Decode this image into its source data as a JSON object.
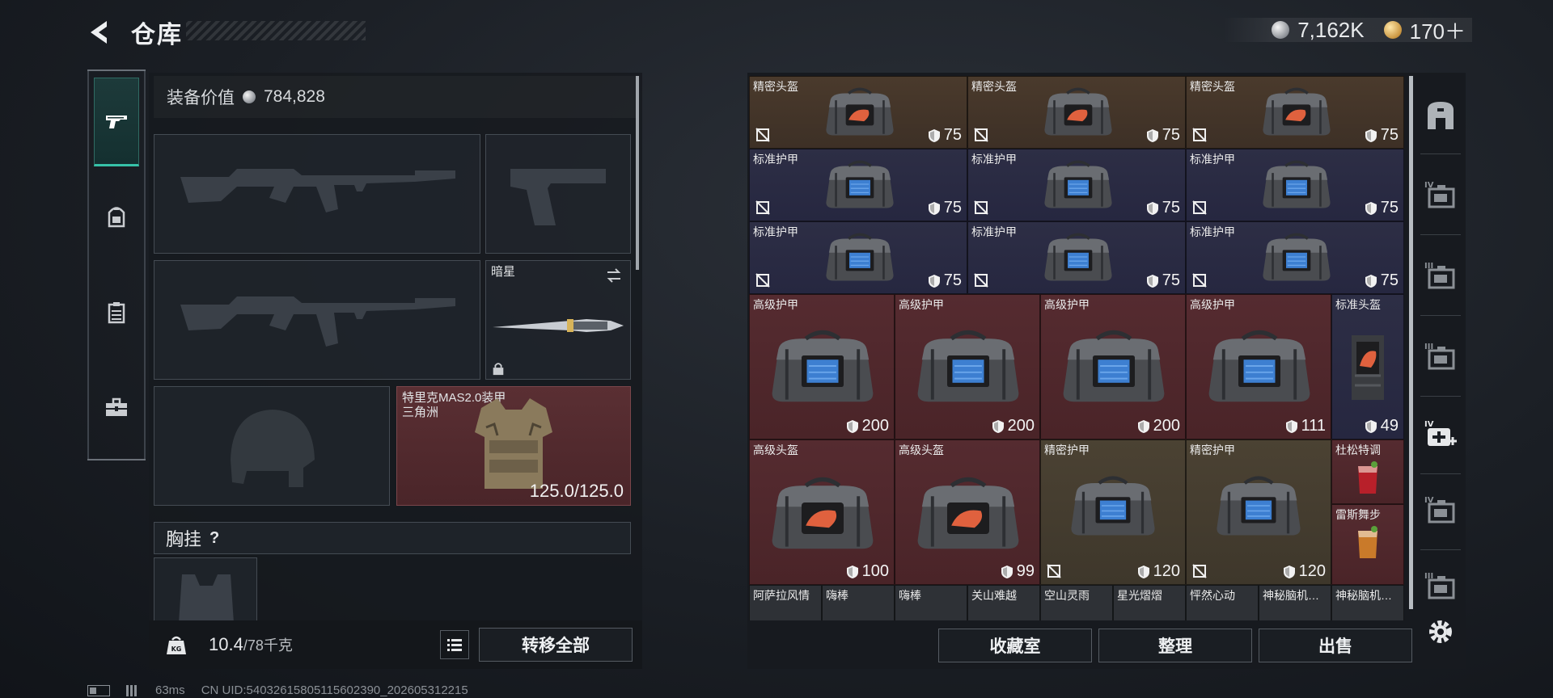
{
  "header": {
    "title": "仓库",
    "currencies": [
      {
        "icon": "silver-coin-icon",
        "value": "7,162K"
      },
      {
        "icon": "gold-coin-icon",
        "value": "170＋"
      }
    ]
  },
  "left_sidebar": {
    "items": [
      {
        "icon": "pistol-icon",
        "active": true
      },
      {
        "icon": "backpack-icon",
        "active": false
      },
      {
        "icon": "clipboard-icon",
        "active": false
      },
      {
        "icon": "toolbox-icon",
        "active": false
      }
    ]
  },
  "equipment": {
    "value_label": "装备价值",
    "value": "784,828",
    "melee_slot": {
      "label": "暗星"
    },
    "armor_slot": {
      "name": "特里克MAS2.0装甲",
      "subtitle": "三角洲",
      "durability": "125.0/125.0"
    },
    "chest_rig_label": "胸挂",
    "chest_rig_help": "?",
    "weight": "10.4",
    "weight_max": "/78千克",
    "weight_icon_text": "KG",
    "transfer_all": "转移全部"
  },
  "stash": {
    "rows": [
      [
        {
          "name": "精密头盔",
          "dur": "75",
          "bg": "brown",
          "kind": "helmet"
        },
        {
          "name": "精密头盔",
          "dur": "75",
          "bg": "brown",
          "kind": "helmet"
        },
        {
          "name": "精密头盔",
          "dur": "75",
          "bg": "brown",
          "kind": "helmet"
        }
      ],
      [
        {
          "name": "标准护甲",
          "dur": "75",
          "bg": "navy",
          "kind": "armor"
        },
        {
          "name": "标准护甲",
          "dur": "75",
          "bg": "navy",
          "kind": "armor"
        },
        {
          "name": "标准护甲",
          "dur": "75",
          "bg": "navy",
          "kind": "armor"
        }
      ],
      [
        {
          "name": "标准护甲",
          "dur": "75",
          "bg": "navy",
          "kind": "armor"
        },
        {
          "name": "标准护甲",
          "dur": "75",
          "bg": "navy",
          "kind": "armor"
        },
        {
          "name": "标准护甲",
          "dur": "75",
          "bg": "navy",
          "kind": "armor"
        }
      ]
    ],
    "big_row_1": [
      {
        "name": "高级护甲",
        "dur": "200",
        "bg": "red",
        "kind": "armor"
      },
      {
        "name": "高级护甲",
        "dur": "200",
        "bg": "red",
        "kind": "armor"
      },
      {
        "name": "高级护甲",
        "dur": "200",
        "bg": "red",
        "kind": "armor"
      },
      {
        "name": "高级护甲",
        "dur": "111",
        "bg": "red",
        "kind": "armor"
      }
    ],
    "helmet_single": {
      "name": "标准头盔",
      "dur": "49"
    },
    "big_row_2": [
      {
        "name": "高级头盔",
        "dur": "100",
        "bg": "red",
        "kind": "helmet"
      },
      {
        "name": "高级头盔",
        "dur": "99",
        "bg": "red",
        "kind": "helmet"
      },
      {
        "name": "精密护甲",
        "dur": "120",
        "bg": "olive",
        "kind": "armor"
      },
      {
        "name": "精密护甲",
        "dur": "120",
        "bg": "olive",
        "kind": "armor"
      }
    ],
    "drinks": [
      {
        "name": "杜松特调"
      },
      {
        "name": "雷斯舞步"
      }
    ],
    "small_row": [
      "阿萨拉风情",
      "嗨棒",
      "嗨棒",
      "关山难越",
      "空山灵雨",
      "星光熠熠",
      "怦然心动",
      "神秘脑机…",
      "神秘脑机…"
    ]
  },
  "stash_buttons": [
    "收藏室",
    "整理",
    "出售"
  ],
  "right_rail": [
    {
      "icon": "safe-box-icon",
      "tier": ""
    },
    {
      "icon": "case-tier4-icon",
      "tier": "IV"
    },
    {
      "icon": "case-tier3-icon",
      "tier": "III"
    },
    {
      "icon": "case-tier3b-icon",
      "tier": "III"
    },
    {
      "icon": "medkit-tier4-icon",
      "tier": "IV"
    },
    {
      "icon": "case-tier4b-icon",
      "tier": "IV"
    },
    {
      "icon": "case-tier3c-icon",
      "tier": "III"
    },
    {
      "icon": "settings-icon",
      "tier": ""
    }
  ],
  "status_bar": {
    "ping": "63ms",
    "uid": "CN UID:5403261580511560239​0_202605312215"
  },
  "colors": {
    "accent": "#36c2a8",
    "armor_slot": "#4a2529",
    "item_brown": "#3d3026",
    "item_navy": "#262740",
    "item_red": "#4a2428",
    "item_olive": "#3e372b"
  }
}
